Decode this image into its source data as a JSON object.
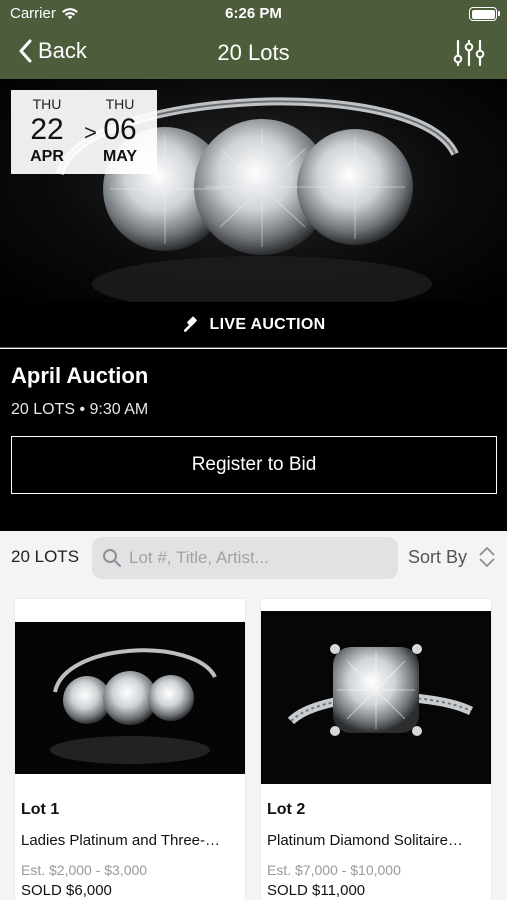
{
  "status_bar": {
    "carrier": "Carrier",
    "time": "6:26 PM",
    "battery_level": 1.0
  },
  "nav": {
    "back_label": "Back",
    "title": "20 Lots",
    "filter_icon": "sliders-icon"
  },
  "dates": {
    "start": {
      "dow": "THU",
      "day": "22",
      "month": "APR"
    },
    "separator": ">",
    "end": {
      "dow": "THU",
      "day": "06",
      "month": "MAY"
    }
  },
  "live_badge": {
    "icon": "gavel-icon",
    "label": "LIVE AUCTION"
  },
  "auction": {
    "name": "April Auction",
    "meta": "20 LOTS • 9:30 AM",
    "register_label": "Register to Bid"
  },
  "toolbar": {
    "count": "20 LOTS",
    "search_placeholder": "Lot #, Title, Artist...",
    "sort_label": "Sort By"
  },
  "lots": [
    {
      "lot": "Lot 1",
      "title": "Ladies Platinum and Three-…",
      "estimate": "Est. $2,000 - $3,000",
      "sold": "SOLD $6,000"
    },
    {
      "lot": "Lot 2",
      "title": "Platinum Diamond Solitaire…",
      "estimate": "Est. $7,000 - $10,000",
      "sold": "SOLD $11,000"
    }
  ],
  "colors": {
    "nav_bg": "#4d5c3a",
    "black": "#000000",
    "muted": "#999999"
  }
}
